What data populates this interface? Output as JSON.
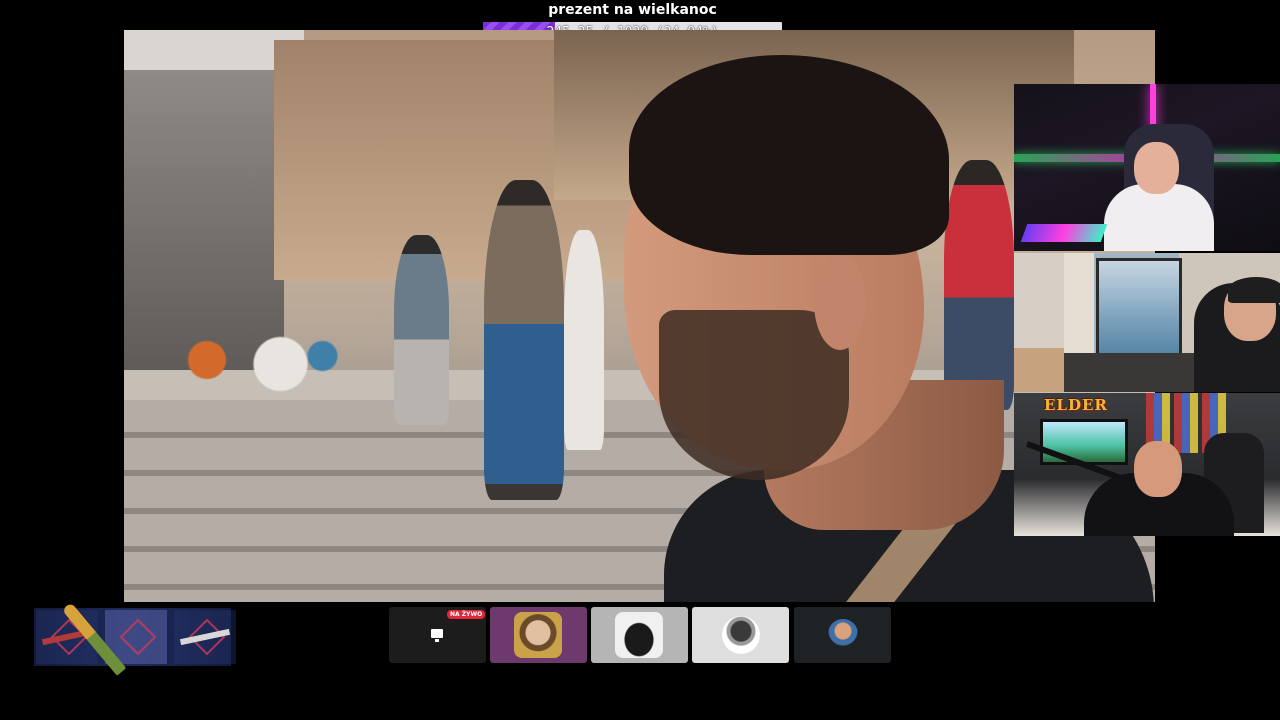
{
  "goal": {
    "title": "prezent na wielkanoc",
    "progress_text": "245.25 / 1020 (24.04%)",
    "current": 245.25,
    "target": 1020,
    "percent": 24.04,
    "bar_color": "#8a3ee6"
  },
  "main_video": {
    "description_icon": "video-frame"
  },
  "webcams": {
    "elder_logo": "ELDER"
  },
  "bottom_tiles": {
    "live_badge": "NA ŻYWO",
    "live_icon": "monitor-icon",
    "live_accent": "#e2263a"
  },
  "colors": {
    "background": "#000000",
    "goal_track": "#e4e2e6"
  }
}
